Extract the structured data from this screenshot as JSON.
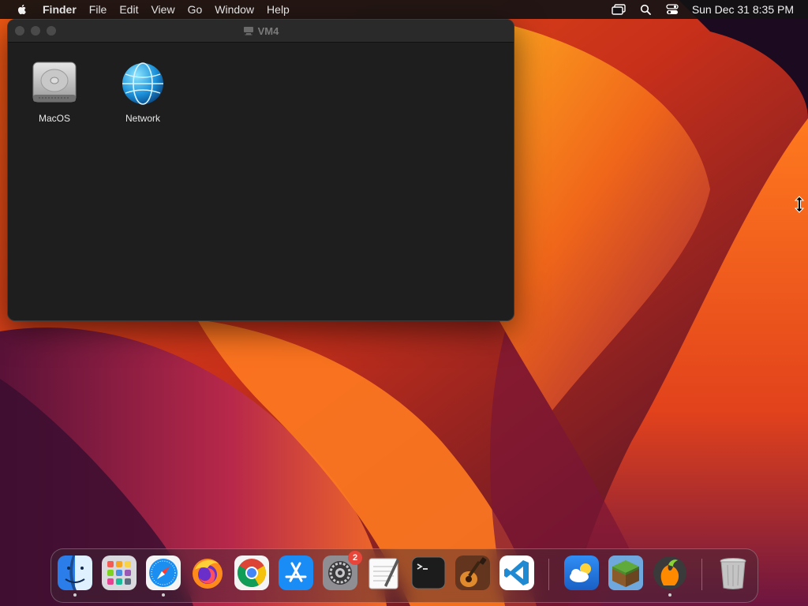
{
  "menubar": {
    "app_name": "Finder",
    "menus": [
      "File",
      "Edit",
      "View",
      "Go",
      "Window",
      "Help"
    ],
    "clock": "Sun Dec 31  8:35 PM",
    "status_icons": [
      "screen-mirroring-icon",
      "spotlight-search-icon",
      "control-center-icon"
    ]
  },
  "window": {
    "title": "VM4",
    "items": [
      {
        "label": "MacOS",
        "icon": "hard-drive-icon"
      },
      {
        "label": "Network",
        "icon": "network-globe-icon"
      }
    ]
  },
  "dock": {
    "apps": [
      {
        "name": "Finder",
        "icon": "finder-icon",
        "running": true
      },
      {
        "name": "Launchpad",
        "icon": "launchpad-icon",
        "running": false
      },
      {
        "name": "Safari",
        "icon": "safari-icon",
        "running": true
      },
      {
        "name": "Firefox",
        "icon": "firefox-icon",
        "running": false
      },
      {
        "name": "Chrome",
        "icon": "chrome-icon",
        "running": false
      },
      {
        "name": "App Store",
        "icon": "app-store-icon",
        "running": false
      },
      {
        "name": "System Settings",
        "icon": "system-settings-icon",
        "running": false,
        "badge": "2"
      },
      {
        "name": "TextEdit",
        "icon": "textedit-icon",
        "running": false
      },
      {
        "name": "Terminal",
        "icon": "terminal-icon",
        "running": false
      },
      {
        "name": "GarageBand",
        "icon": "garageband-icon",
        "running": false
      },
      {
        "name": "Visual Studio Code",
        "icon": "vscode-icon",
        "running": false
      },
      {
        "name": "Weather",
        "icon": "weather-icon",
        "running": false
      },
      {
        "name": "Minecraft",
        "icon": "minecraft-icon",
        "running": false
      },
      {
        "name": "FL Studio",
        "icon": "fl-studio-icon",
        "running": true
      },
      {
        "name": "Trash",
        "icon": "trash-icon",
        "running": false
      }
    ]
  },
  "colors": {
    "menubar_bg": "#141214",
    "window_bg": "#1e1e1e",
    "badge_red": "#e9463b"
  }
}
